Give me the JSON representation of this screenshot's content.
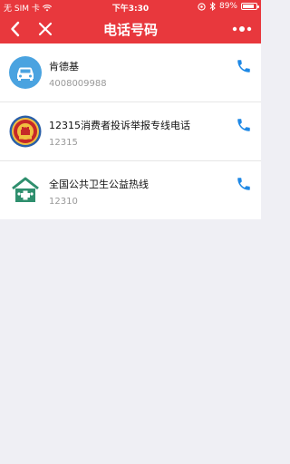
{
  "status_bar": {
    "carrier": "无 SIM 卡",
    "time": "下午3:30",
    "battery_percent": "89%",
    "battery_level": 0.89
  },
  "navbar": {
    "title": "电话号码",
    "back_icon": "chevron-left-icon",
    "close_icon": "close-icon",
    "more_icon": "more-dots-icon"
  },
  "contacts": [
    {
      "name": "肯德基",
      "number": "4008009988",
      "icon": "car-icon"
    },
    {
      "name": "12315消费者投诉举报专线电话",
      "number": "12315",
      "icon": "emblem-icon"
    },
    {
      "name": "全国公共卫生公益热线",
      "number": "12310",
      "icon": "health-house-icon"
    }
  ],
  "colors": {
    "header": "#e8383d",
    "call_icon": "#1e88e5",
    "car_icon_bg": "#4aa3e0",
    "health_icon": "#2f8f6e"
  }
}
